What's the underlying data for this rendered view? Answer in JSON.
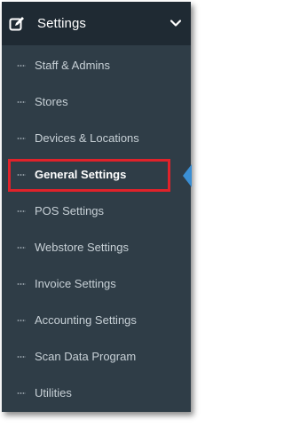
{
  "menu": {
    "title": "Settings",
    "header_icon": "edit-icon",
    "toggle_icon": "chevron-down-icon",
    "items": [
      {
        "label": "Staff & Admins"
      },
      {
        "label": "Stores"
      },
      {
        "label": "Devices & Locations"
      },
      {
        "label": "General Settings",
        "active": true
      },
      {
        "label": "POS Settings"
      },
      {
        "label": "Webstore Settings"
      },
      {
        "label": "Invoice Settings"
      },
      {
        "label": "Accounting Settings"
      },
      {
        "label": "Scan Data Program"
      },
      {
        "label": "Utilities"
      }
    ]
  },
  "colors": {
    "panel_bg": "#2f3d47",
    "header_bg": "#1f2a33",
    "highlight": "#e0222a",
    "active_marker": "#3b8fd4"
  }
}
